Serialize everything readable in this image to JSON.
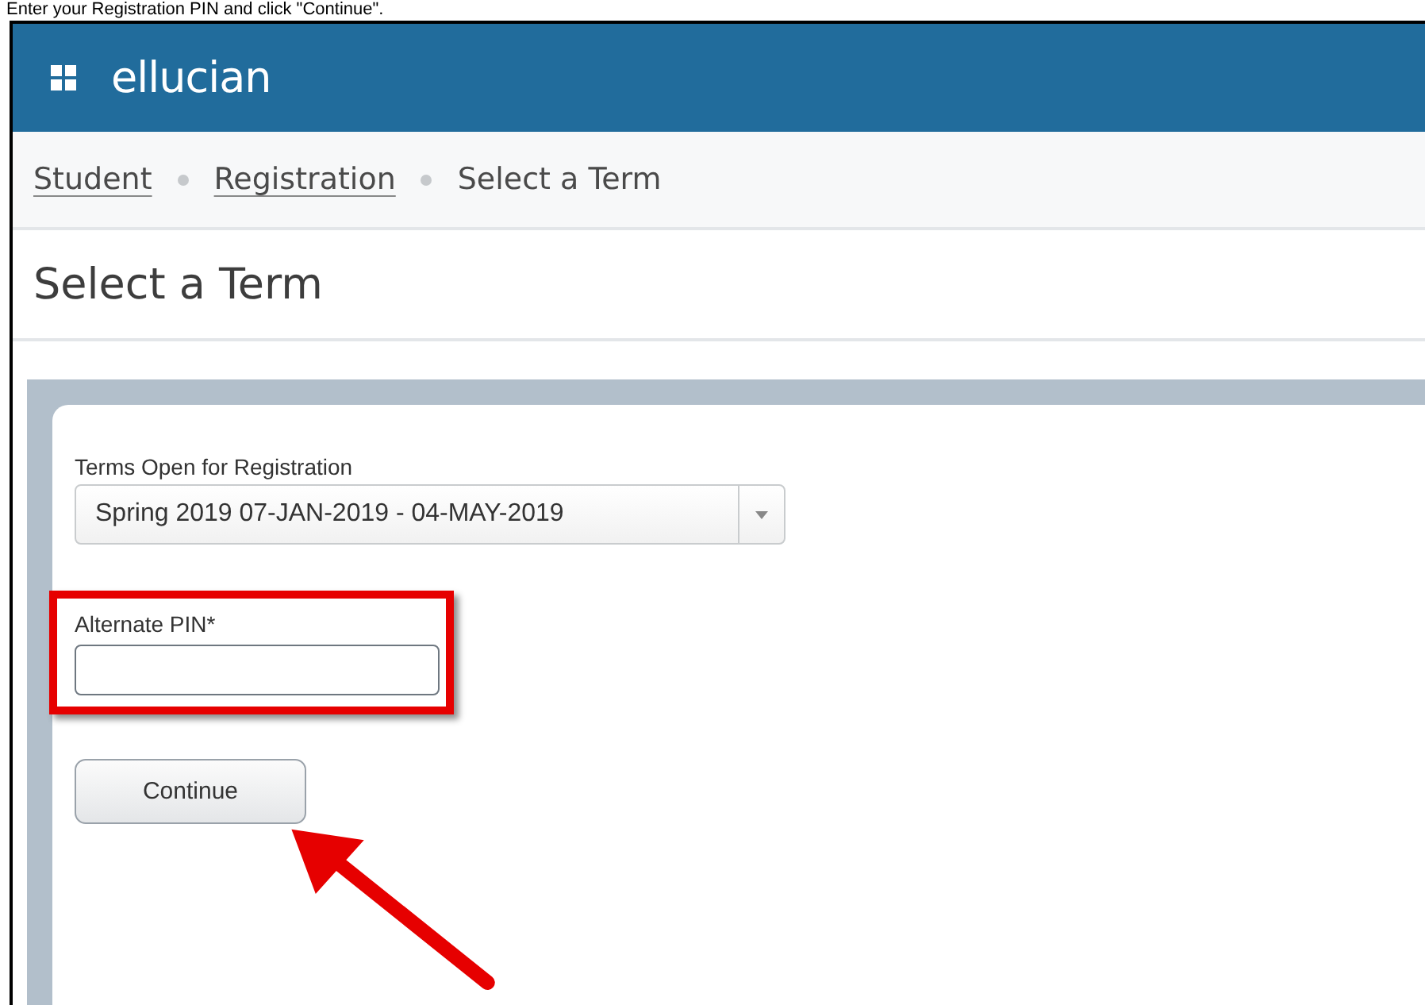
{
  "caption": "Enter your Registration PIN and click \"Continue\".",
  "header": {
    "brand": "ellucian"
  },
  "breadcrumbs": [
    {
      "label": "Student",
      "link": true
    },
    {
      "label": "Registration",
      "link": true
    },
    {
      "label": "Select a Term",
      "link": false
    }
  ],
  "page_title": "Select a Term",
  "form": {
    "term_label": "Terms Open for Registration",
    "term_value": "Spring 2019 07-JAN-2019 - 04-MAY-2019",
    "pin_label": "Alternate PIN*",
    "continue_button": "Continue"
  }
}
